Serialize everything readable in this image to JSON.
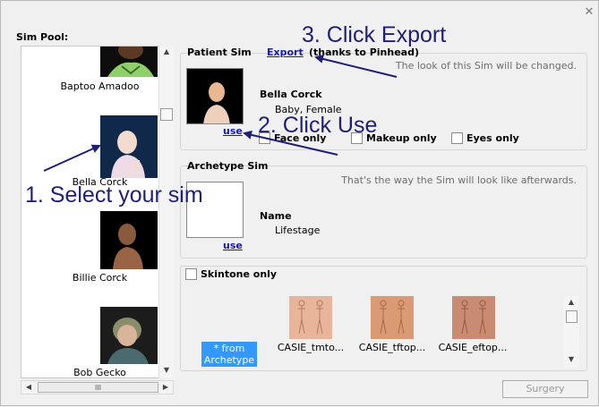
{
  "window": {
    "close_glyph": "✕"
  },
  "pool": {
    "label": "Sim Pool:",
    "sims": [
      {
        "name": "Baptoo Amadoo"
      },
      {
        "name": "Bella Corck"
      },
      {
        "name": "Billie Corck"
      },
      {
        "name": "Bob Gecko"
      }
    ],
    "hscroll_grip": "III"
  },
  "patient": {
    "title": "Patient Sim",
    "export_label": "Export",
    "thanks": "(thanks to Pinhead)",
    "hint": "The look of this Sim will be changed.",
    "name": "Bella Corck",
    "info": "Baby, Female",
    "use_label": "use",
    "options": [
      {
        "label": "Face only",
        "checked": false
      },
      {
        "label": "Makeup only",
        "checked": false
      },
      {
        "label": "Eyes only",
        "checked": false
      }
    ]
  },
  "archetype": {
    "title": "Archetype Sim",
    "hint": "That's the way the Sim will look like afterwards.",
    "name": "Name",
    "info": "Lifestage",
    "use_label": "use"
  },
  "skintone": {
    "label": "Skintone only",
    "checked": false,
    "from_archetype": "* from Archetype",
    "tones": [
      {
        "label": "CASIE_tmto...",
        "color": "#e8b59a"
      },
      {
        "label": "CASIE_tftop...",
        "color": "#d99a74"
      },
      {
        "label": "CASIE_eftop...",
        "color": "#c98b72"
      }
    ]
  },
  "surgery_label": "Surgery",
  "annotations": {
    "step1": "1. Select your sim",
    "step2": "2. Click Use",
    "step3": "3. Click Export",
    "color": "#1f1f78"
  }
}
